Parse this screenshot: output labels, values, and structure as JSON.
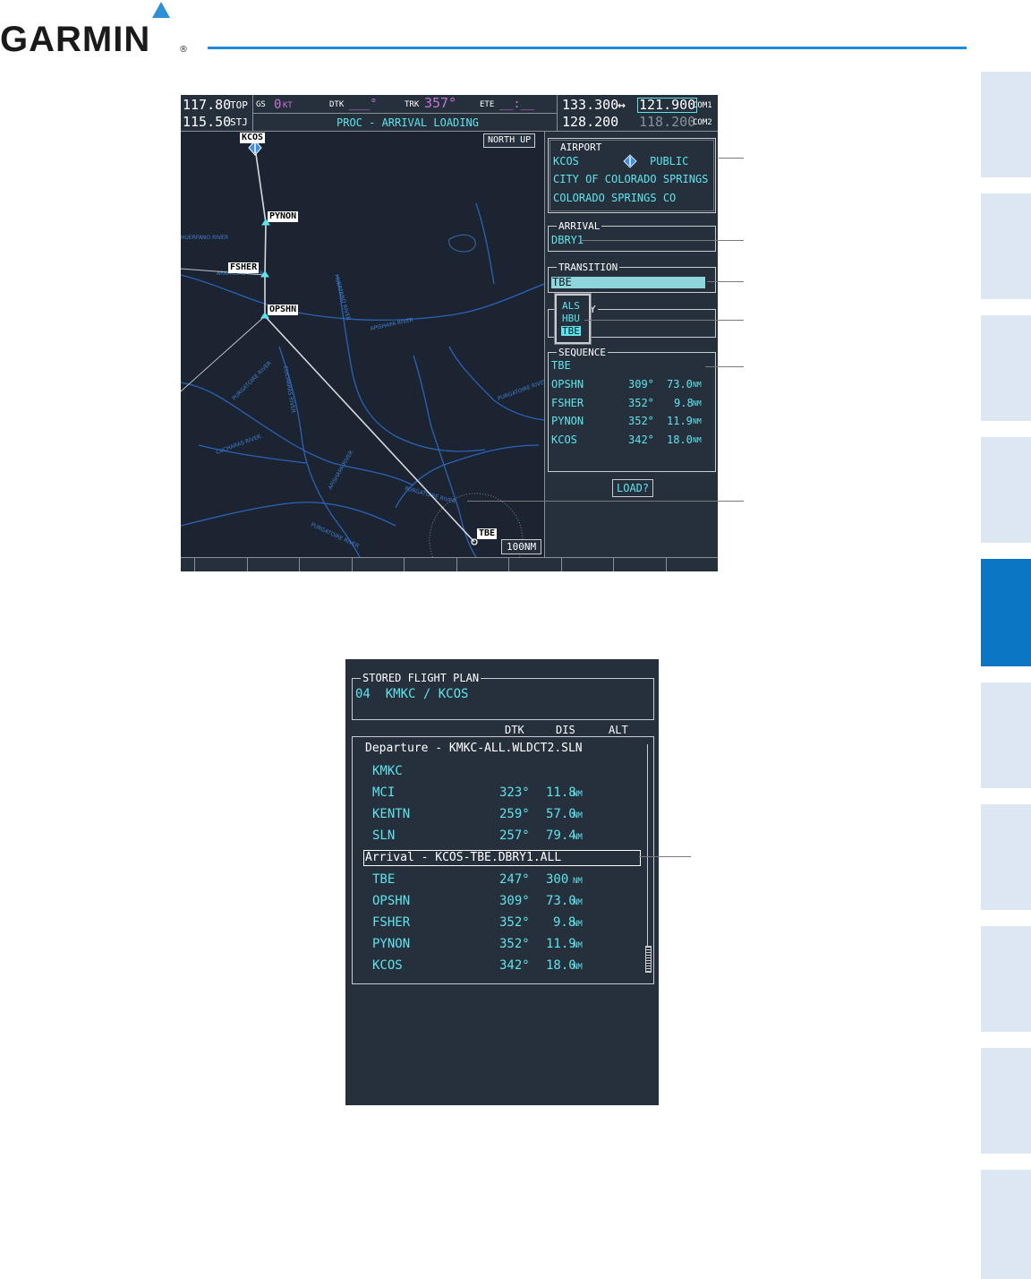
{
  "header": {
    "brand": "GARMIN",
    "registered": "®"
  },
  "mfd": {
    "top_bar": {
      "nav1_active": "117.80",
      "nav1_id": "TOP",
      "nav2_active": "115.50",
      "nav2_id": "STJ",
      "gs_label": "GS",
      "gs_value": "0",
      "gs_unit": "KT",
      "dtk_label": "DTK",
      "dtk_value": "___°",
      "trk_label": "TRK",
      "trk_value": "357°",
      "ete_label": "ETE",
      "ete_value": "__:__",
      "page_title": "PROC - ARRIVAL LOADING",
      "com1_active": "133.300",
      "com_arrow": "↔",
      "com1_standby": "121.900",
      "com1_label": "COM1",
      "com2_active": "128.200",
      "com2_standby": "118.200",
      "com2_label": "COM2"
    },
    "map": {
      "orientation": "NORTH UP",
      "range": "100NM",
      "waypoints": [
        {
          "id": "KCOS"
        },
        {
          "id": "PYNON"
        },
        {
          "id": "FSHER"
        },
        {
          "id": "OPSHN"
        },
        {
          "id": "TBE"
        }
      ],
      "rivers": [
        "ARKANSAS RIVER",
        "HUERFANO RIVER",
        "APISHAPA RIVER",
        "CUCHARAS RIVER",
        "PURGATOIRE RIVER",
        "HUERFANO RIVER",
        "APISHAPA RIVER",
        "PURGATOIRE RIVER",
        "PURGATOIRE RIVER",
        "PURGATOIRE RIVER",
        "CUCHARAS RIVER"
      ]
    },
    "airport": {
      "label": "AIRPORT",
      "ident": "KCOS",
      "type": "PUBLIC",
      "city": "CITY OF COLORADO SPRINGS",
      "location": "COLORADO SPRINGS CO"
    },
    "arrival": {
      "label": "ARRIVAL",
      "value": "DBRY1"
    },
    "transition": {
      "label": "TRANSITION",
      "value": "TBE",
      "options": [
        "ALS",
        "HBU",
        "TBE"
      ],
      "selected_index": 2
    },
    "runway": {
      "label": "Y"
    },
    "sequence": {
      "label": "SEQUENCE",
      "first": "TBE",
      "legs": [
        {
          "wpt": "OPSHN",
          "dtk": "309°",
          "dis": "73.0",
          "unit": "NM"
        },
        {
          "wpt": "FSHER",
          "dtk": "352°",
          "dis": "9.8",
          "unit": "NM"
        },
        {
          "wpt": "PYNON",
          "dtk": "352°",
          "dis": "11.9",
          "unit": "NM"
        },
        {
          "wpt": "KCOS",
          "dtk": "342°",
          "dis": "18.0",
          "unit": "NM"
        }
      ]
    },
    "load_button": "LOAD?"
  },
  "stored_flight_plan": {
    "label": "STORED FLIGHT PLAN",
    "plan": "04  KMKC / KCOS",
    "headers": {
      "dtk": "DTK",
      "dis": "DIS",
      "alt": "ALT"
    },
    "departure_header": "Departure - KMKC-ALL.WLDCT2.SLN",
    "departure_legs": [
      {
        "wpt": "KMKC",
        "dtk": "",
        "dis": "",
        "unit": ""
      },
      {
        "wpt": "MCI",
        "dtk": "323°",
        "dis": "11.8",
        "unit": "NM"
      },
      {
        "wpt": "KENTN",
        "dtk": "259°",
        "dis": "57.0",
        "unit": "NM"
      },
      {
        "wpt": "SLN",
        "dtk": "257°",
        "dis": "79.4",
        "unit": "NM"
      }
    ],
    "arrival_header": "Arrival - KCOS-TBE.DBRY1.ALL",
    "arrival_legs": [
      {
        "wpt": "TBE",
        "dtk": "247°",
        "dis": "300",
        "unit": "NM"
      },
      {
        "wpt": "OPSHN",
        "dtk": "309°",
        "dis": "73.0",
        "unit": "NM"
      },
      {
        "wpt": "FSHER",
        "dtk": "352°",
        "dis": "9.8",
        "unit": "NM"
      },
      {
        "wpt": "PYNON",
        "dtk": "352°",
        "dis": "11.9",
        "unit": "NM"
      },
      {
        "wpt": "KCOS",
        "dtk": "342°",
        "dis": "18.0",
        "unit": "NM"
      }
    ]
  },
  "colors": {
    "screen_bg": "#26303d",
    "cyan": "#5fe4ec",
    "magenta": "#c573d6",
    "river": "#2a63b8",
    "tab_active": "#0a76c4",
    "tab_inactive": "#dde6f3",
    "brand_blue": "#1f8ad8"
  }
}
